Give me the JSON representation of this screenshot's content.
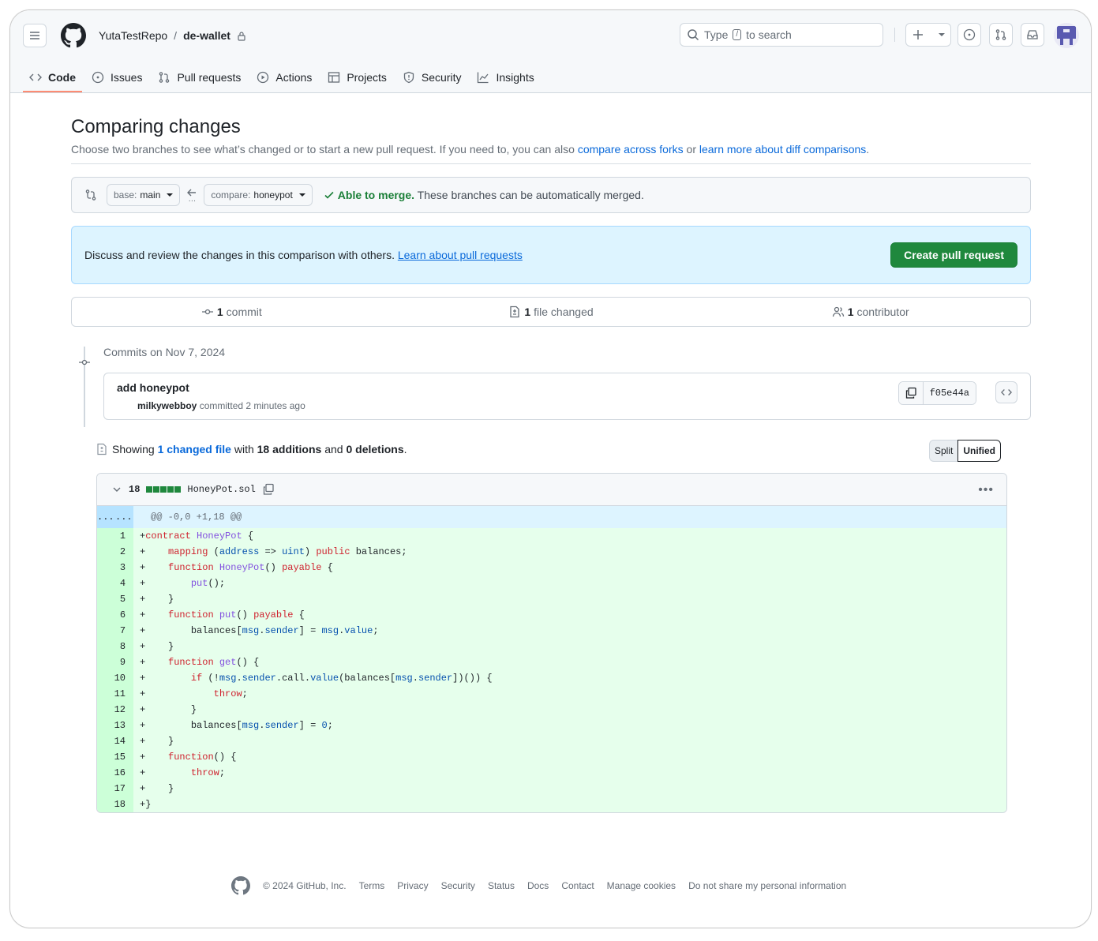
{
  "header": {
    "owner": "YutaTestRepo",
    "separator": "/",
    "repo": "de-wallet",
    "search": {
      "prefix": "Type",
      "key": "/",
      "suffix": "to search"
    }
  },
  "nav": [
    {
      "label": "Code",
      "icon": "code-icon",
      "active": true
    },
    {
      "label": "Issues",
      "icon": "issue-icon"
    },
    {
      "label": "Pull requests",
      "icon": "pull-request-icon"
    },
    {
      "label": "Actions",
      "icon": "play-icon"
    },
    {
      "label": "Projects",
      "icon": "table-icon"
    },
    {
      "label": "Security",
      "icon": "shield-icon"
    },
    {
      "label": "Insights",
      "icon": "graph-icon"
    }
  ],
  "page": {
    "title": "Comparing changes",
    "subtitle_text": "Choose two branches to see what’s changed or to start a new pull request. If you need to, you can also ",
    "link_forks": "compare across forks",
    "or": " or ",
    "link_learn": "learn more about diff comparisons",
    "period": "."
  },
  "range": {
    "base_label": "base:",
    "base_value": "main",
    "compare_label": "compare:",
    "compare_value": "honeypot",
    "merge_status": "Able to merge.",
    "merge_text": " These branches can be automatically merged."
  },
  "flash": {
    "text": "Discuss and review the changes in this comparison with others. ",
    "link": "Learn about pull requests",
    "button": "Create pull request"
  },
  "stats": {
    "commits_count": "1",
    "commits_label": "commit",
    "files_count": "1",
    "files_label": "file changed",
    "contributors_count": "1",
    "contributors_label": "contributor"
  },
  "commits": {
    "date_heading": "Commits on Nov 7, 2024",
    "title": "add honeypot",
    "author": "milkywebboy",
    "meta": " committed 2 minutes ago",
    "sha": "f05e44a"
  },
  "summary": {
    "prefix": "Showing ",
    "link": "1 changed file",
    "mid": " with ",
    "additions": "18 additions",
    "and": " and ",
    "deletions": "0 deletions",
    "end": "."
  },
  "view_toggle": {
    "split": "Split",
    "unified": "Unified"
  },
  "file": {
    "changes": "18",
    "name": "HoneyPot.sol",
    "hunk_left": "...",
    "hunk_right": "...",
    "hunk_header": "@@ -0,0 +1,18 @@",
    "lines": [
      "contract HoneyPot {",
      "    mapping (address => uint) public balances;",
      "    function HoneyPot() payable {",
      "        put();",
      "    }",
      "    function put() payable {",
      "        balances[msg.sender] = msg.value;",
      "    }",
      "    function get() {",
      "        if (!msg.sender.call.value(balances[msg.sender])()) {",
      "            throw;",
      "        }",
      "        balances[msg.sender] = 0;",
      "    }",
      "    function() {",
      "        throw;",
      "    }",
      "}"
    ]
  },
  "footer": {
    "copyright": "© 2024 GitHub, Inc.",
    "links": [
      "Terms",
      "Privacy",
      "Security",
      "Status",
      "Docs",
      "Contact",
      "Manage cookies",
      "Do not share my personal information"
    ]
  },
  "colors": {
    "accent_green": "#1f883d",
    "link_blue": "#0969da",
    "nav_underline": "#fd8c73",
    "addition_bg": "#e6ffec",
    "hunk_bg": "#ddf4ff"
  }
}
